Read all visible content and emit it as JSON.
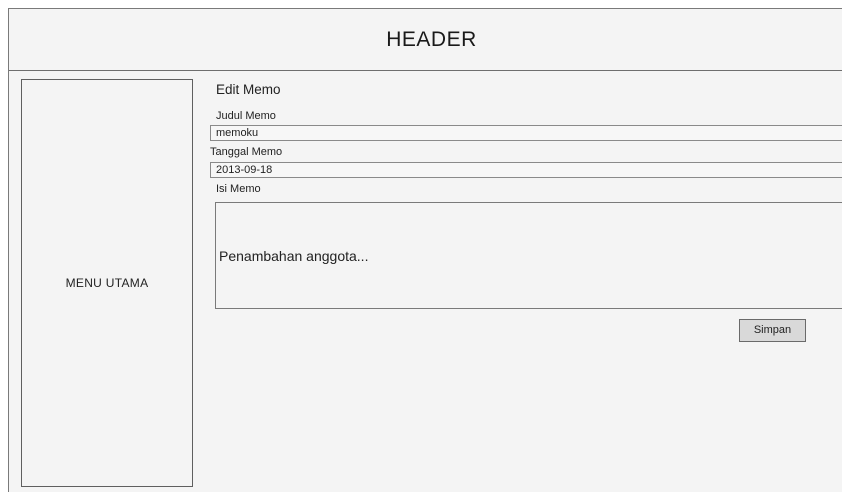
{
  "header": {
    "title": "HEADER"
  },
  "sidebar": {
    "label": "MENU UTAMA"
  },
  "form": {
    "title": "Edit Memo",
    "memo_title_label": "Judul Memo",
    "memo_title_value": "memoku",
    "memo_date_label": "Tanggal Memo",
    "memo_date_value": "2013-09-18",
    "memo_body_label": "Isi Memo",
    "memo_body_value": "Penambahan anggota...",
    "save_label": "Simpan"
  }
}
